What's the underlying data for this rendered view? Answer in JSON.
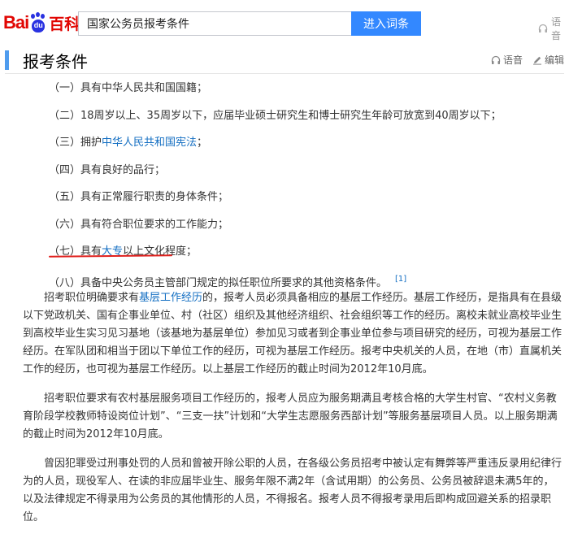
{
  "header": {
    "logo": {
      "bai": "Bai",
      "du": "du",
      "baike": "百科"
    },
    "search_value": "国家公务员报考条件",
    "search_button": "进入词条",
    "voice_label": "语音"
  },
  "section": {
    "title": "报考条件",
    "tools": {
      "voice": "语音",
      "edit": "编辑"
    }
  },
  "conditions": [
    {
      "text": "（一）具有中华人民共和国国籍；"
    },
    {
      "text": "（二）18周岁以上、35周岁以下，应届毕业硕士研究生和博士研究生年龄可放宽到40周岁以下；"
    },
    {
      "before": "（三）拥护",
      "link": "中华人民共和国宪法",
      "after": "；"
    },
    {
      "text": "（四）具有良好的品行；"
    },
    {
      "text": "（五）具有正常履行职责的身体条件；"
    },
    {
      "text": "（六）具有符合职位要求的工作能力；"
    },
    {
      "before": "（七）具有",
      "link": "大专",
      "after": "以上文化程度；"
    },
    {
      "text": "（八）具备中央公务员主管部门规定的拟任职位所要求的其他资格条件。",
      "ref": "[1]"
    }
  ],
  "paragraphs": [
    {
      "before": "招考职位明确要求有",
      "link": "基层工作经历",
      "after": "的，报考人员必须具备相应的基层工作经历。基层工作经历，是指具有在县级以下党政机关、国有企事业单位、村（社区）组织及其他经济组织、社会组织等工作的经历。离校未就业高校毕业生到高校毕业生实习见习基地（该基地为基层单位）参加见习或者到企事业单位参与项目研究的经历，可视为基层工作经历。在军队团和相当于团以下单位工作的经历，可视为基层工作经历。报考中央机关的人员，在地（市）直属机关工作的经历，也可视为基层工作经历。以上基层工作经历的截止时间为2012年10月底。"
    },
    {
      "text": "招考职位要求有农村基层服务项目工作经历的，报考人员应为服务期满且考核合格的大学生村官、“农村义务教育阶段学校教师特设岗位计划”、“三支一扶”计划和“大学生志愿服务西部计划”等服务基层项目人员。以上服务期满的截止时间为2012年10月底。"
    },
    {
      "text": "曾因犯罪受过刑事处罚的人员和曾被开除公职的人员，在各级公务员招考中被认定有舞弊等严重违反录用纪律行为的人员，现役军人、在读的非应届毕业生、服务年限不满2年（含试用期）的公务员、公务员被辞退未满5年的，以及法律规定不得录用为公务员的其他情形的人员，不得报名。报考人员不得报考录用后即构成回避关系的招录职位。"
    }
  ],
  "colors": {
    "accent": "#3388ff",
    "link": "#136ec2",
    "title_bar": "#4f9cee",
    "underline": "#e0201d",
    "logo_red": "#e10602",
    "logo_blue": "#2932e1"
  },
  "icons": {
    "header_voice": "headphones-icon",
    "section_voice": "headphones-icon",
    "edit": "pencil-icon"
  }
}
